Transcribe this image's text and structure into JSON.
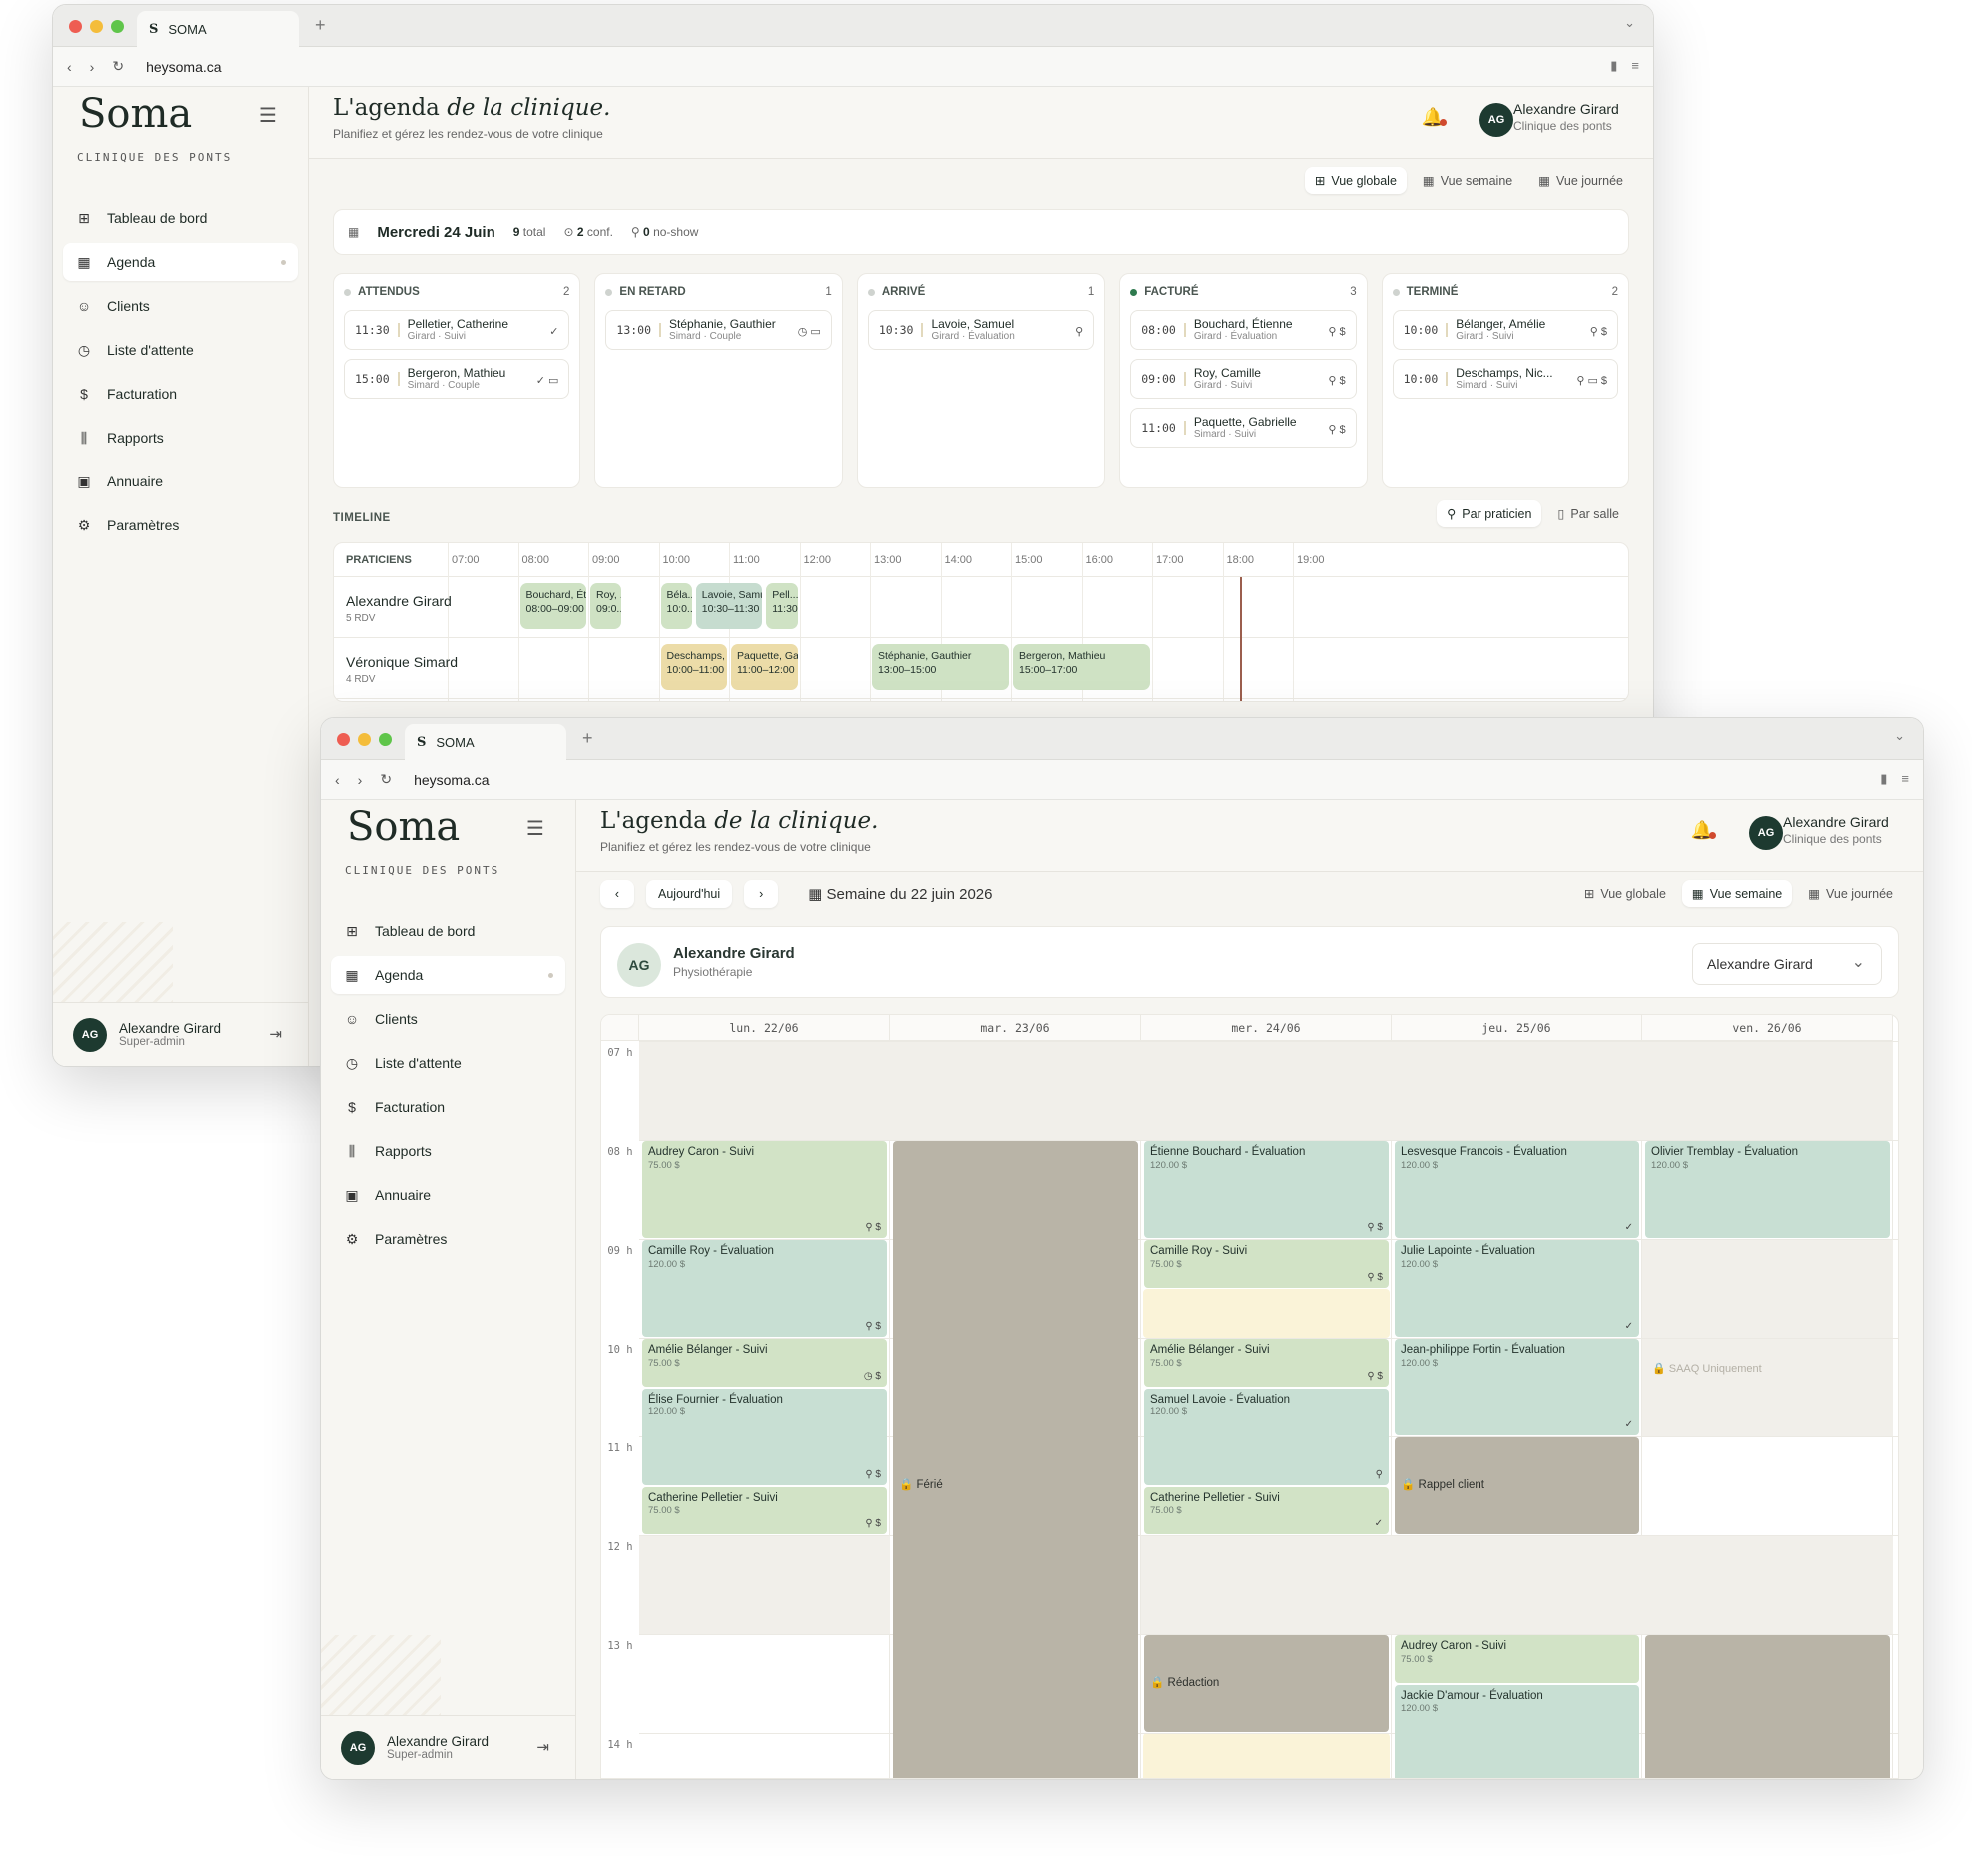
{
  "browser": {
    "tab_title": "SOMA",
    "tab_fav": "S",
    "url": "heysoma.ca"
  },
  "brand": {
    "logo": "Soma",
    "subtitle": "CLINIQUE DES PONTS"
  },
  "nav": [
    {
      "label": "Tableau de bord",
      "icon": "dashboard-icon",
      "glyph": "⊞"
    },
    {
      "label": "Agenda",
      "icon": "calendar-icon",
      "glyph": "▦"
    },
    {
      "label": "Clients",
      "icon": "users-icon",
      "glyph": "☺"
    },
    {
      "label": "Liste d'attente",
      "icon": "clock-icon",
      "glyph": "◷"
    },
    {
      "label": "Facturation",
      "icon": "invoice-icon",
      "glyph": "$"
    },
    {
      "label": "Rapports",
      "icon": "chart-icon",
      "glyph": "⫼"
    },
    {
      "label": "Annuaire",
      "icon": "contact-icon",
      "glyph": "▣"
    },
    {
      "label": "Paramètres",
      "icon": "gear-icon",
      "glyph": "⚙"
    }
  ],
  "header": {
    "title_a": "L'agenda ",
    "title_b": "de la clinique.",
    "subtitle": "Planifiez et gérez les rendez-vous de votre clinique"
  },
  "user": {
    "initials": "AG",
    "name": "Alexandre Girard",
    "clinic": "Clinique des ponts",
    "role": "Super-admin"
  },
  "views": {
    "global": "Vue globale",
    "week": "Vue semaine",
    "day": "Vue journée"
  },
  "day": {
    "date": "Mercredi 24 Juin",
    "total_n": "9",
    "total_l": "total",
    "conf_n": "2",
    "conf_l": "conf.",
    "noshow_n": "0",
    "noshow_l": "no-show"
  },
  "columns": [
    {
      "title": "ATTENDUS",
      "count": "2",
      "dot": "#cfd3cf",
      "items": [
        {
          "time": "11:30",
          "name": "Pelletier, Catherine",
          "meta": "Girard · Suivi",
          "icons": "✓"
        },
        {
          "time": "15:00",
          "name": "Bergeron, Mathieu",
          "meta": "Simard · Couple",
          "icons": "✓ ▭"
        }
      ]
    },
    {
      "title": "EN RETARD",
      "count": "1",
      "dot": "#cfd3cf",
      "items": [
        {
          "time": "13:00",
          "name": "Stéphanie, Gauthier",
          "meta": "Simard · Couple",
          "icons": "◷ ▭"
        }
      ]
    },
    {
      "title": "ARRIVÉ",
      "count": "1",
      "dot": "#cfd3cf",
      "items": [
        {
          "time": "10:30",
          "name": "Lavoie, Samuel",
          "meta": "Girard · Évaluation",
          "icons": "⚲"
        }
      ]
    },
    {
      "title": "FACTURÉ",
      "count": "3",
      "dot": "#2e7a4e",
      "items": [
        {
          "time": "08:00",
          "name": "Bouchard, Étienne",
          "meta": "Girard · Évaluation",
          "icons": "⚲ $"
        },
        {
          "time": "09:00",
          "name": "Roy, Camille",
          "meta": "Girard · Suivi",
          "icons": "⚲ $"
        },
        {
          "time": "11:00",
          "name": "Paquette, Gabrielle",
          "meta": "Simard · Suivi",
          "icons": "⚲ $"
        }
      ]
    },
    {
      "title": "TERMINÉ",
      "count": "2",
      "dot": "#cfd3cf",
      "items": [
        {
          "time": "10:00",
          "name": "Bélanger, Amélie",
          "meta": "Girard · Suivi",
          "icons": "⚲ $"
        },
        {
          "time": "10:00",
          "name": "Deschamps, Nic...",
          "meta": "Simard · Suivi",
          "icons": "⚲ ▭ $"
        }
      ]
    }
  ],
  "timeline": {
    "label": "TIMELINE",
    "by_prac": "Par praticien",
    "by_room": "Par salle",
    "col_head": "PRATICIENS",
    "hours": [
      "07:00",
      "08:00",
      "09:00",
      "10:00",
      "11:00",
      "12:00",
      "13:00",
      "14:00",
      "15:00",
      "16:00",
      "17:00",
      "18:00",
      "19:00"
    ],
    "rows": [
      {
        "name": "Alexandre Girard",
        "count": "5 RDV",
        "blocks": [
          {
            "l": "Bouchard, Ét...",
            "t": "08:00–09:00",
            "s": 8,
            "e": 9,
            "c": "bg"
          },
          {
            "l": "Roy, ...",
            "t": "09:0...",
            "s": 9,
            "e": 9.5,
            "c": "bg"
          },
          {
            "l": "Béla...",
            "t": "10:0...",
            "s": 10,
            "e": 10.5,
            "c": "bg"
          },
          {
            "l": "Lavoie, Samu...",
            "t": "10:30–11:30",
            "s": 10.5,
            "e": 11.5,
            "c": "bt"
          },
          {
            "l": "Pell...",
            "t": "11:30...",
            "s": 11.5,
            "e": 12,
            "c": "bg"
          }
        ]
      },
      {
        "name": "Véronique Simard",
        "count": "4 RDV",
        "blocks": [
          {
            "l": "Deschamps, ...",
            "t": "10:00–11:00",
            "s": 10,
            "e": 11,
            "c": "by"
          },
          {
            "l": "Paquette, Ga...",
            "t": "11:00–12:00",
            "s": 11,
            "e": 12,
            "c": "by"
          },
          {
            "l": "Stéphanie, Gauthier",
            "t": "13:00–15:00",
            "s": 13,
            "e": 15,
            "c": "bg"
          },
          {
            "l": "Bergeron, Mathieu",
            "t": "15:00–17:00",
            "s": 15,
            "e": 17,
            "c": "bg"
          }
        ]
      }
    ]
  },
  "week": {
    "prev": "‹",
    "today": "Aujourd'hui",
    "next": "›",
    "label": "Semaine du 22 juin 2026",
    "prac_initials": "AG",
    "prac_name": "Alexandre Girard",
    "prac_spec": "Physiothérapie",
    "select": "Alexandre Girard",
    "days": [
      "lun. 22/06",
      "mar. 23/06",
      "mer. 24/06",
      "jeu. 25/06",
      "ven. 26/06"
    ],
    "hours": [
      "07 h",
      "08 h",
      "09 h",
      "10 h",
      "11 h",
      "12 h",
      "13 h",
      "14 h"
    ],
    "events": [
      {
        "d": 0,
        "s": 8,
        "e": 9,
        "t": "Audrey Caron - Suivi",
        "p": "75.00 $",
        "c": "eg",
        "i": "⚲ $"
      },
      {
        "d": 0,
        "s": 9,
        "e": 10,
        "t": "Camille Roy - Évaluation",
        "p": "120.00 $",
        "c": "et",
        "i": "⚲ $"
      },
      {
        "d": 0,
        "s": 10,
        "e": 10.5,
        "t": "Amélie Bélanger - Suivi",
        "p": "75.00 $",
        "c": "eg",
        "i": "◷ $"
      },
      {
        "d": 0,
        "s": 10.5,
        "e": 11.5,
        "t": "Élise Fournier - Évaluation",
        "p": "120.00 $",
        "c": "et",
        "i": "⚲ $"
      },
      {
        "d": 0,
        "s": 11.5,
        "e": 12,
        "t": "Catherine Pelletier - Suivi",
        "p": "75.00 $",
        "c": "eg",
        "i": "⚲ $"
      },
      {
        "d": 1,
        "s": 8,
        "e": 15,
        "t": "🔒 Férié",
        "p": "",
        "c": "egr",
        "i": "",
        "mid": true
      },
      {
        "d": 2,
        "s": 8,
        "e": 9,
        "t": "Étienne Bouchard - Évaluation",
        "p": "120.00 $",
        "c": "et",
        "i": "⚲ $"
      },
      {
        "d": 2,
        "s": 9,
        "e": 9.5,
        "t": "Camille Roy - Suivi",
        "p": "75.00 $",
        "c": "eg",
        "i": "⚲ $"
      },
      {
        "d": 2,
        "s": 10,
        "e": 10.5,
        "t": "Amélie Bélanger - Suivi",
        "p": "75.00 $",
        "c": "eg",
        "i": "⚲ $"
      },
      {
        "d": 2,
        "s": 10.5,
        "e": 11.5,
        "t": "Samuel Lavoie - Évaluation",
        "p": "120.00 $",
        "c": "et",
        "i": "⚲"
      },
      {
        "d": 2,
        "s": 11.5,
        "e": 12,
        "t": "Catherine Pelletier - Suivi",
        "p": "75.00 $",
        "c": "eg",
        "i": "✓"
      },
      {
        "d": 2,
        "s": 13,
        "e": 14,
        "t": "🔒 Rédaction",
        "p": "",
        "c": "egr",
        "i": "",
        "mid": true
      },
      {
        "d": 3,
        "s": 8,
        "e": 9,
        "t": "Lesvesque Francois - Évaluation",
        "p": "120.00 $",
        "c": "et",
        "i": "✓"
      },
      {
        "d": 3,
        "s": 9,
        "e": 10,
        "t": "Julie Lapointe - Évaluation",
        "p": "120.00 $",
        "c": "et",
        "i": "✓"
      },
      {
        "d": 3,
        "s": 10,
        "e": 11,
        "t": "Jean-philippe Fortin - Évaluation",
        "p": "120.00 $",
        "c": "et",
        "i": "✓"
      },
      {
        "d": 3,
        "s": 11,
        "e": 12,
        "t": "🔒 Rappel client",
        "p": "",
        "c": "egr",
        "i": "",
        "mid": true
      },
      {
        "d": 3,
        "s": 13,
        "e": 13.5,
        "t": "Audrey Caron - Suivi",
        "p": "75.00 $",
        "c": "eg",
        "i": ""
      },
      {
        "d": 3,
        "s": 13.5,
        "e": 15,
        "t": "Jackie D'amour - Évaluation",
        "p": "120.00 $",
        "c": "et",
        "i": ""
      },
      {
        "d": 4,
        "s": 8,
        "e": 9,
        "t": "Olivier Tremblay - Évaluation",
        "p": "120.00 $",
        "c": "et",
        "i": ""
      },
      {
        "d": 4,
        "s": 13,
        "e": 15,
        "t": "",
        "p": "",
        "c": "egr",
        "i": ""
      }
    ],
    "saaq": "🔒 SAAQ Uniquement"
  }
}
